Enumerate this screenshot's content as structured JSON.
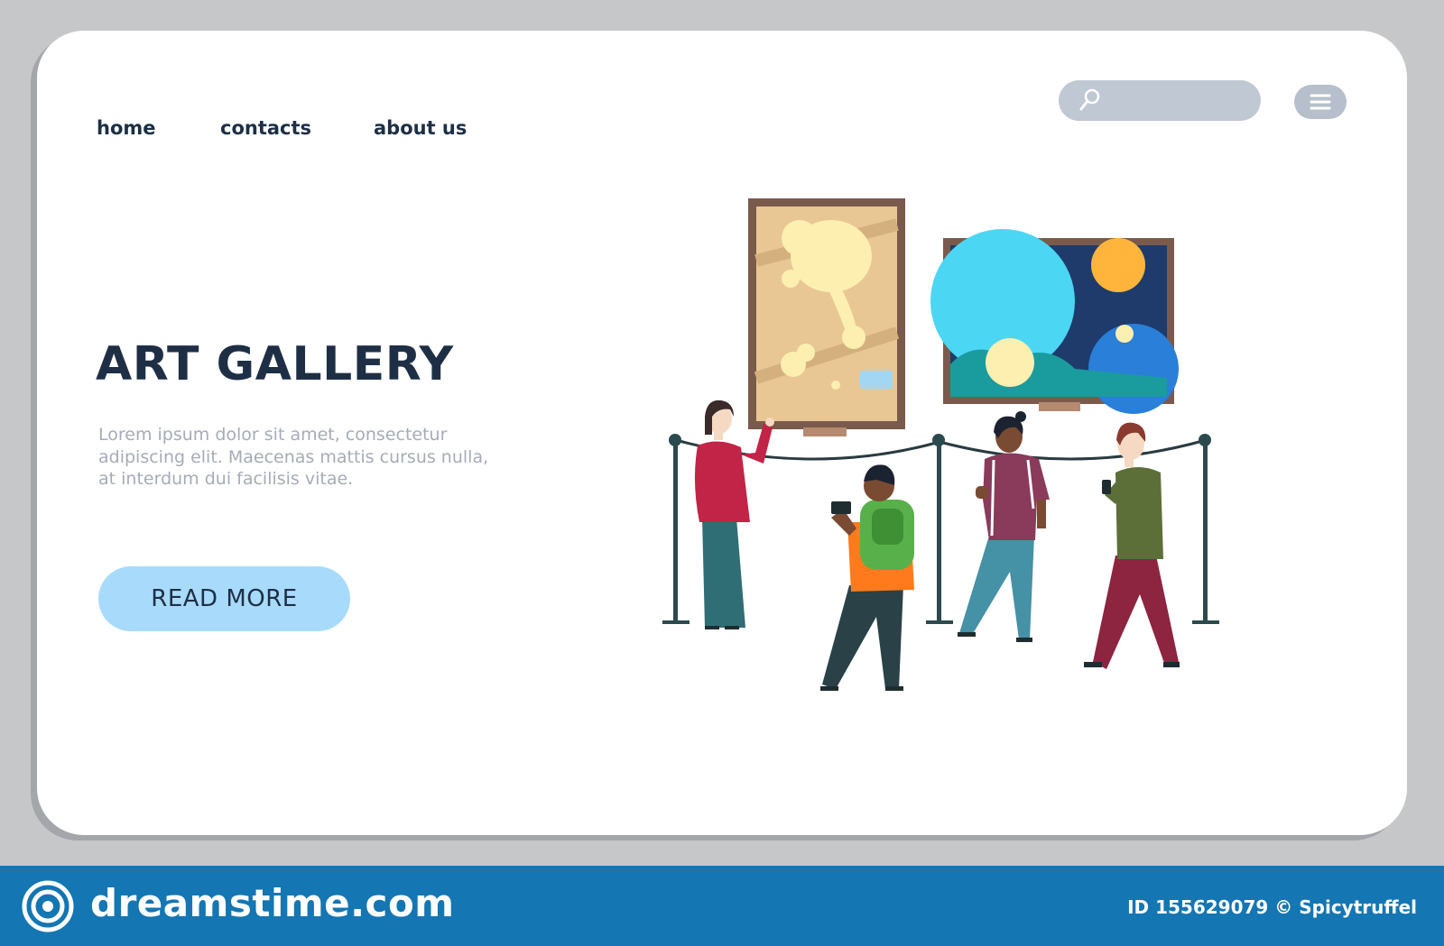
{
  "nav": {
    "links": [
      {
        "label": "home"
      },
      {
        "label": "contacts"
      },
      {
        "label": "about us"
      }
    ],
    "search_icon": "search-icon",
    "menu_icon": "hamburger-menu-icon"
  },
  "hero": {
    "title": "ART GALLERY",
    "description": "Lorem ipsum dolor sit amet, consectetur adipiscing elit. Maecenas mattis cursus nulla, at interdum dui facilisis vitae.",
    "button_label": "READ MORE"
  },
  "illustration": {
    "subject": "gallery-visitors-illustration"
  },
  "footer": {
    "brand": "dreamstime.com",
    "credit": "ID 155629079 © Spicytruffel"
  },
  "colors": {
    "text_dark": "#1e2f45",
    "text_muted": "#a5acb7",
    "button_bg": "#a8dbfb",
    "footer_bg": "#1476b2",
    "page_bg": "#c6c7c9"
  }
}
